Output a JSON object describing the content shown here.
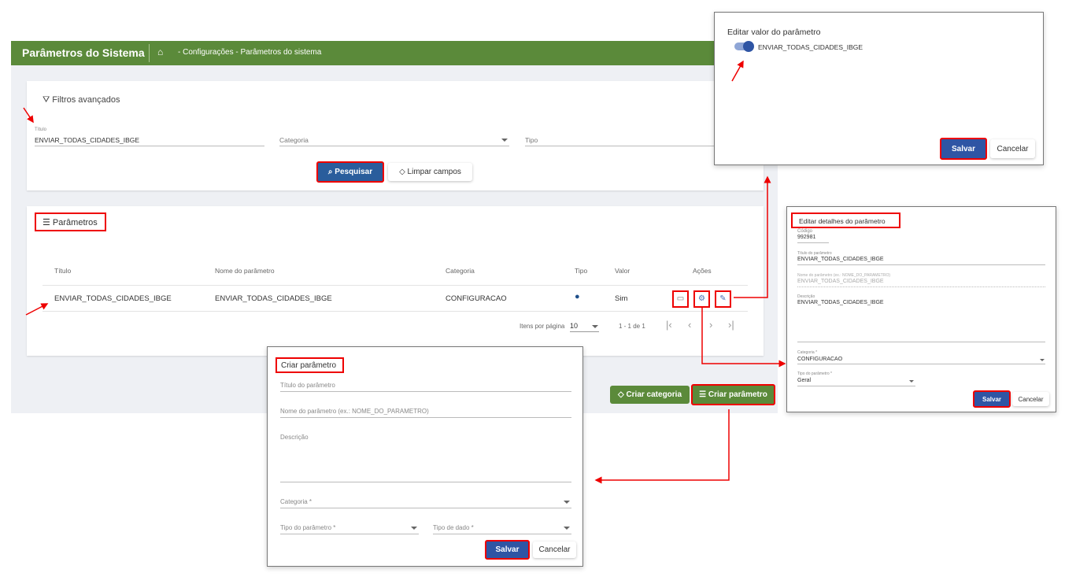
{
  "header": {
    "title": "Parâmetros do Sistema",
    "breadcrumb": "- Configurações - Parâmetros do sistema"
  },
  "filters": {
    "title": "Filtros avançados",
    "titulo_label": "Título",
    "titulo_value": "ENVIAR_TODAS_CIDADES_IBGE",
    "categoria_placeholder": "Categoria",
    "tipo_placeholder": "Tipo",
    "search_label": "Pesquisar",
    "clear_label": "Limpar campos"
  },
  "params": {
    "title": "Parâmetros",
    "columns": [
      "Título",
      "Nome do parâmetro",
      "Categoria",
      "Tipo",
      "Valor",
      "Ações"
    ],
    "rows": [
      {
        "titulo": "ENVIAR_TODAS_CIDADES_IBGE",
        "nome": "ENVIAR_TODAS_CIDADES_IBGE",
        "categoria": "CONFIGURACAO",
        "tipo_icon": "globe-icon",
        "valor": "Sim"
      }
    ],
    "items_per_page_label": "Itens por página",
    "items_per_page": "10",
    "range": "1 - 1 de 1"
  },
  "actions": {
    "create_category": "Criar categoria",
    "create_param": "Criar parâmetro"
  },
  "edit_value": {
    "title": "Editar valor do parâmetro",
    "toggle_label": "ENVIAR_TODAS_CIDADES_IBGE",
    "toggle_on": true,
    "save": "Salvar",
    "cancel": "Cancelar"
  },
  "edit_details": {
    "title": "Editar detalhes do parâmetro",
    "codigo_label": "Código",
    "codigo": "992981",
    "titulo_label": "Título do parâmetro",
    "titulo": "ENVIAR_TODAS_CIDADES_IBGE",
    "nome_label": "Nome do parâmetro (ex.: NOME_DO_PARAMETRO)",
    "nome": "ENVIAR_TODAS_CIDADES_IBGE",
    "descricao_label": "Descrição",
    "descricao": "ENVIAR_TODAS_CIDADES_IBGE",
    "categoria_label": "Categoria *",
    "categoria": "CONFIGURACAO",
    "tipo_label": "Tipo do parâmetro *",
    "tipo": "Geral",
    "save": "Salvar",
    "cancel": "Cancelar"
  },
  "create": {
    "title": "Criar parâmetro",
    "titulo_placeholder": "Título do parâmetro",
    "nome_placeholder": "Nome do parâmetro (ex.: NOME_DO_PARAMETRO)",
    "descricao_placeholder": "Descrição",
    "categoria_placeholder": "Categoria *",
    "tipo_param_placeholder": "Tipo do parâmetro *",
    "tipo_dado_placeholder": "Tipo de dado *",
    "save": "Salvar",
    "cancel": "Cancelar"
  },
  "colors": {
    "header": "#5b8a3a",
    "primary": "#2f55a4",
    "highlight": "#e00000"
  }
}
